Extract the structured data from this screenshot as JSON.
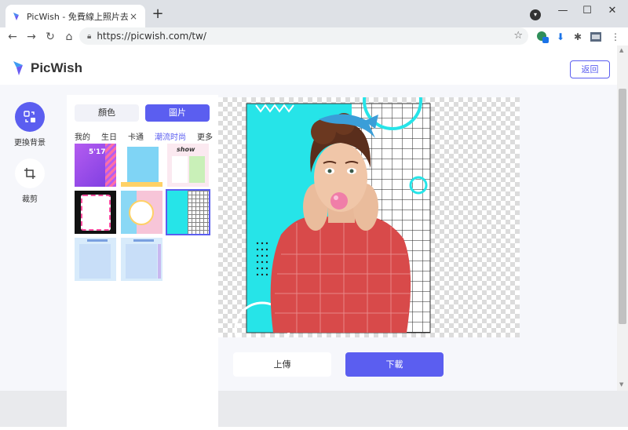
{
  "browser": {
    "tab_title": "PicWish - 免費線上照片去背，綠",
    "tab_close": "×",
    "new_tab": "+",
    "url": "https://picwish.com/tw/",
    "ext_badge": "1"
  },
  "header": {
    "brand": "PicWish",
    "back_label": "返回"
  },
  "leftnav": {
    "items": [
      {
        "label": "更換背景"
      },
      {
        "label": "裁剪"
      }
    ]
  },
  "panel": {
    "tabs": [
      {
        "label": "顏色",
        "active": false
      },
      {
        "label": "圖片",
        "active": true
      }
    ],
    "categories": [
      "我的",
      "生日",
      "卡通",
      "潮流时尚",
      "更多"
    ],
    "active_category": 3,
    "thumb_texts": [
      "5'17",
      "show"
    ]
  },
  "actions": {
    "upload_label": "上傳",
    "download_label": "下載"
  },
  "colors": {
    "accent": "#5b5ef0",
    "cyan": "#26e4e8",
    "shirt": "#d84a4a"
  }
}
